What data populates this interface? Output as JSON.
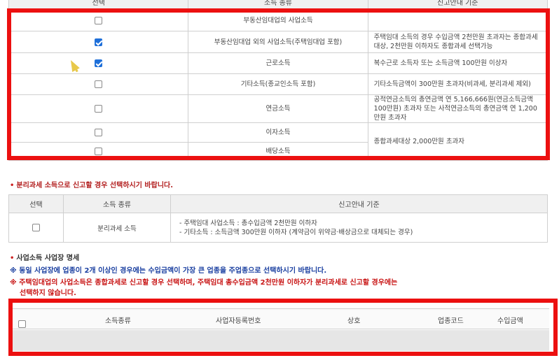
{
  "top_table": {
    "headers": {
      "select": "선택",
      "kind": "소득 종류",
      "guide": "신고안내 기준"
    },
    "rows": [
      {
        "checked": false,
        "kind": "부동산임대업의 사업소득",
        "guide": ""
      },
      {
        "checked": true,
        "kind": "부동산임대업 외의 사업소득(주택임대업 포함)",
        "guide": "주택임대 소득의 경우 수입금액 2천만원 초과자는 종합과세 대상, 2천만원 이하자도 종합과세 선택가능"
      },
      {
        "checked": true,
        "kind": "근로소득",
        "guide": "복수근로 소득자 또는 소득금액 100만원 이상자"
      },
      {
        "checked": false,
        "kind": "기타소득(종교인소득 포함)",
        "guide": "기타소득금액이 300만원 초과자(비과세, 분리과세 제외)"
      },
      {
        "checked": false,
        "kind": "연금소득",
        "guide": "공적연금소득의 총연금액 연 5,166,666원(연금소득금액 100만원) 초과자 또는 사적연금소득의 총연금액 연 1,200만원 초과자"
      },
      {
        "checked": false,
        "kind": "이자소득",
        "guide": ""
      },
      {
        "checked": false,
        "kind": "배당소득",
        "guide": ""
      }
    ],
    "merged_guide": "종합과세대상 2,000만원 초과자"
  },
  "separate_section": {
    "title": "분리과세 소득으로 신고할 경우 선택하시기 바랍니다.",
    "headers": {
      "select": "선택",
      "kind": "소득 종류",
      "guide": "신고안내 기준"
    },
    "row": {
      "checked": false,
      "kind": "분리과세 소득",
      "guide_lines": [
        "- 주택임대 사업소득 : 총수입금액 2천만원 이하자",
        "- 기타소득 : 소득금액 300만원 이하자 (계약금이 위약금·배상금으로 대체되는 경우)"
      ]
    }
  },
  "business_section": {
    "title": "사업소득 사업장 명세",
    "notes": {
      "blue": "※ 동일 사업장에 업종이 2개 이상인 경우에는 수입금액이 가장 큰 업종을 주업종으로 선택하시기 바랍니다.",
      "red_line1": "※ 주택임대업의 사업소득은 종합과세로 신고할 경우 선택하며, 주택임대 총수입금액 2천만원 이하자가 분리과세로 신고할 경우에는",
      "red_line2": "선택하지 않습니다."
    },
    "columns": [
      "소득종류",
      "사업자등록번호",
      "상호",
      "업종코드",
      "수입금액"
    ]
  },
  "colors": {
    "highlight": "#ec1010",
    "checkbox_checked": "#1e6fd9",
    "note_blue": "#1a3fa0",
    "note_red": "#c81414"
  }
}
